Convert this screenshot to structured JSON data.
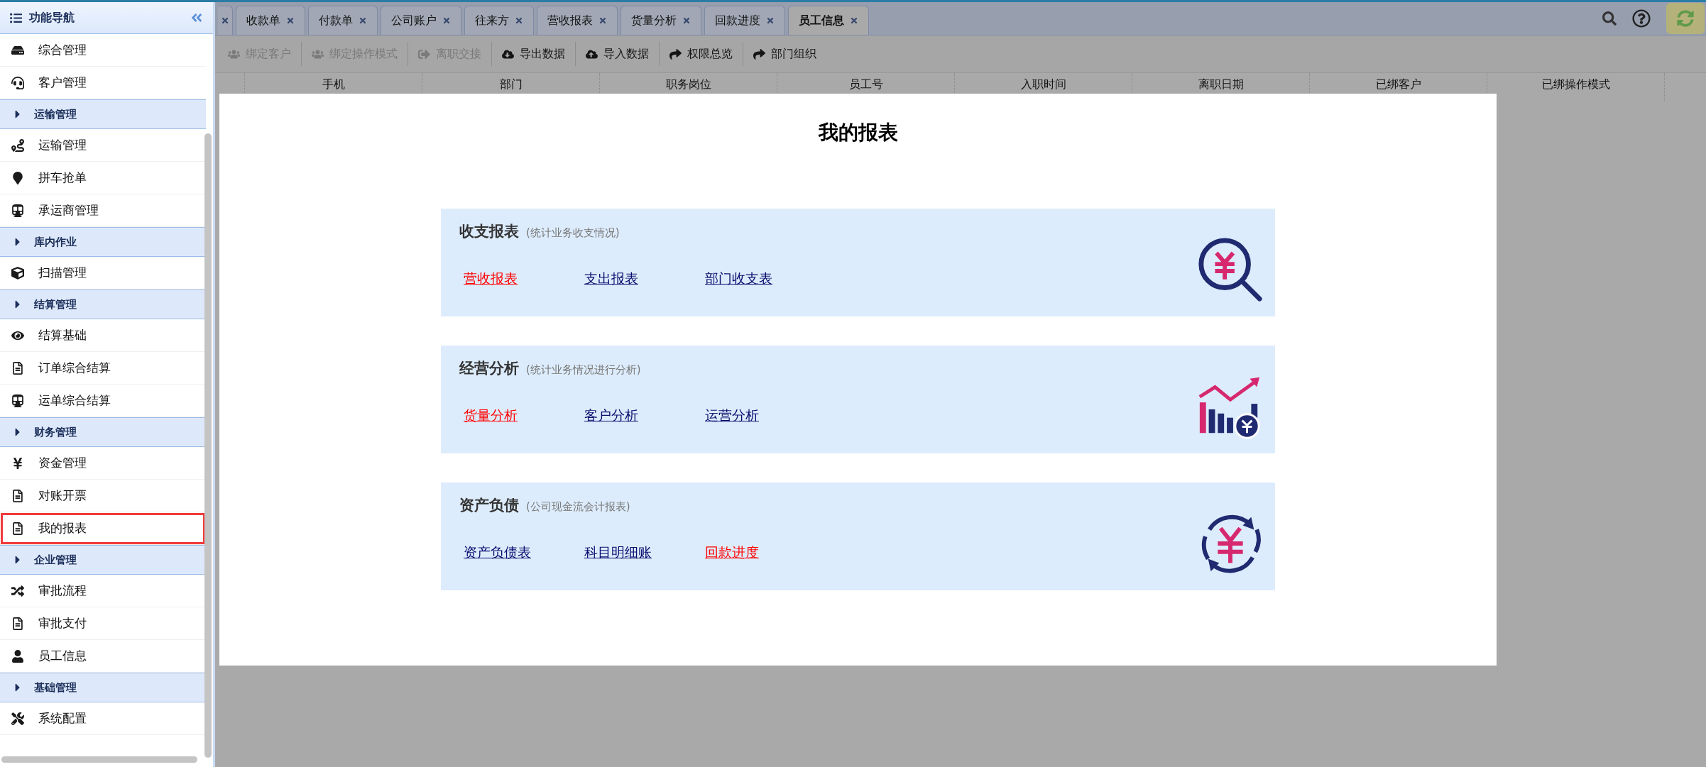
{
  "sidebar": {
    "title": "功能导航",
    "groups": [
      {
        "items": [
          {
            "label": "综合管理",
            "selected": false
          },
          {
            "label": "客户管理",
            "selected": false
          }
        ]
      },
      {
        "label": "运输管理",
        "items": [
          {
            "label": "运输管理",
            "selected": false
          },
          {
            "label": "拼车抢单",
            "selected": false
          },
          {
            "label": "承运商管理",
            "selected": false
          }
        ]
      },
      {
        "label": "库内作业",
        "items": [
          {
            "label": "扫描管理",
            "selected": false
          }
        ]
      },
      {
        "label": "结算管理",
        "items": [
          {
            "label": "结算基础",
            "selected": false
          },
          {
            "label": "订单综合结算",
            "selected": false
          },
          {
            "label": "运单综合结算",
            "selected": false
          }
        ]
      },
      {
        "label": "财务管理",
        "items": [
          {
            "label": "资金管理",
            "selected": false
          },
          {
            "label": "对账开票",
            "selected": false
          },
          {
            "label": "我的报表",
            "selected": true
          }
        ]
      },
      {
        "label": "企业管理",
        "items": [
          {
            "label": "审批流程",
            "selected": false
          },
          {
            "label": "审批支付",
            "selected": false
          },
          {
            "label": "员工信息",
            "selected": false
          }
        ]
      },
      {
        "label": "基础管理",
        "items": [
          {
            "label": "系统配置",
            "selected": false
          }
        ]
      }
    ]
  },
  "tabs": [
    {
      "label": "收款单",
      "selected": false
    },
    {
      "label": "付款单",
      "selected": false
    },
    {
      "label": "公司账户",
      "selected": false
    },
    {
      "label": "往来方",
      "selected": false
    },
    {
      "label": "营收报表",
      "selected": false
    },
    {
      "label": "货量分析",
      "selected": false
    },
    {
      "label": "回款进度",
      "selected": false
    },
    {
      "label": "员工信息",
      "selected": true
    }
  ],
  "toolbar": [
    {
      "label": "绑定客户",
      "disabled": true
    },
    {
      "label": "绑定操作模式",
      "disabled": true
    },
    {
      "label": "离职交接",
      "disabled": true
    },
    {
      "label": "导出数据",
      "disabled": false
    },
    {
      "label": "导入数据",
      "disabled": false
    },
    {
      "label": "权限总览",
      "disabled": false
    },
    {
      "label": "部门组织",
      "disabled": false
    }
  ],
  "table": {
    "columns": [
      "手机",
      "部门",
      "职务岗位",
      "员工号",
      "入职时间",
      "离职日期",
      "已绑客户",
      "已绑操作模式"
    ]
  },
  "dialog": {
    "title": "我的报表",
    "cards": [
      {
        "title": "收支报表",
        "note": "(统计业务收支情况)",
        "links": [
          {
            "label": "营收报表",
            "color": "#ff0000"
          },
          {
            "label": "支出报表",
            "color": "#0a0a6e"
          },
          {
            "label": "部门收支表",
            "color": "#0a0a6e"
          }
        ]
      },
      {
        "title": "经营分析",
        "note": "(统计业务情况进行分析)",
        "links": [
          {
            "label": "货量分析",
            "color": "#ff0000"
          },
          {
            "label": "客户分析",
            "color": "#0a0a6e"
          },
          {
            "label": "运营分析",
            "color": "#0a0a6e"
          }
        ]
      },
      {
        "title": "资产负债",
        "note": "(公司现金流会计报表)",
        "links": [
          {
            "label": "资产负债表",
            "color": "#0a0a6e"
          },
          {
            "label": "科目明细账",
            "color": "#0a0a6e"
          },
          {
            "label": "回款进度",
            "color": "#ff0000"
          }
        ]
      }
    ]
  }
}
